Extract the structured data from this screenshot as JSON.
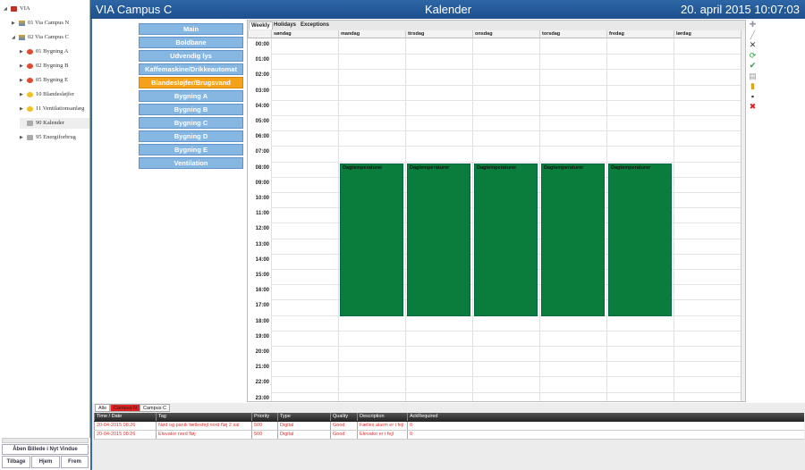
{
  "tree": [
    {
      "label": "VIA",
      "icon": "factory-icon",
      "arrow": "◢",
      "level": 0,
      "color": "#c0302a"
    },
    {
      "label": "01 Via Campus N",
      "icon": "campus-icon",
      "arrow": "▶",
      "level": 1,
      "color": "#e6a020"
    },
    {
      "label": "02 Via Campus C",
      "icon": "campus-icon",
      "arrow": "◢",
      "level": 1,
      "color": "#e6a020"
    },
    {
      "label": "01 Bygning A",
      "icon": "alarm-red-icon",
      "arrow": "▶",
      "level": 2,
      "color": "#e24a2a"
    },
    {
      "label": "02 Bygning B",
      "icon": "alarm-red-icon",
      "arrow": "▶",
      "level": 2,
      "color": "#e24a2a"
    },
    {
      "label": "05 Bygning E",
      "icon": "alarm-red-icon",
      "arrow": "▶",
      "level": 2,
      "color": "#e24a2a"
    },
    {
      "label": "10 Blandesløjfer",
      "icon": "alarm-yellow-icon",
      "arrow": "▶",
      "level": 2,
      "color": "#f2c020"
    },
    {
      "label": "11 Ventilationsanlæg",
      "icon": "alarm-yellow-icon",
      "arrow": "▶",
      "level": 2,
      "color": "#f2c020"
    },
    {
      "label": "90 Kalender",
      "icon": "printer-icon",
      "arrow": "",
      "level": 2,
      "color": "#aaaaaa",
      "selected": true
    },
    {
      "label": "95 Energiforbrug",
      "icon": "printer-icon",
      "arrow": "▶",
      "level": 2,
      "color": "#aaaaaa"
    }
  ],
  "left_buttons": {
    "open": "Åben Billede i Nyt Vindue",
    "back": "Tilbage",
    "home": "Hjem",
    "forward": "Frem"
  },
  "header": {
    "title": "VIA Campus C",
    "center": "Kalender",
    "datetime": "20. april 2015 10:07:03"
  },
  "nav_buttons": [
    "Main",
    "Boldbane",
    "Udvendig lys",
    "Kaffemaskine/Drikkeautomat",
    "Blandesløjfer/Brugsvand",
    "Bygning A",
    "Bygning B",
    "Bygning C",
    "Bygning D",
    "Bygning E",
    "Ventilation"
  ],
  "nav_active": 4,
  "calendar": {
    "tabs": [
      "Weekly",
      "Holidays",
      "Exceptions"
    ],
    "active_tab": 0,
    "days": [
      "søndag",
      "mandag",
      "tirsdag",
      "onsdag",
      "torsdag",
      "fredag",
      "lørdag"
    ],
    "hours": [
      "00:00",
      "01:00",
      "02:00",
      "03:00",
      "04:00",
      "05:00",
      "06:00",
      "07:00",
      "08:00",
      "09:00",
      "10:00",
      "11:00",
      "12:00",
      "13:00",
      "14:00",
      "15:00",
      "16:00",
      "17:00",
      "18:00",
      "19:00",
      "20:00",
      "21:00",
      "22:00",
      "23:00"
    ],
    "events": [
      {
        "day": 1,
        "start": 8,
        "end": 18,
        "label": "Dagtemperaturer"
      },
      {
        "day": 2,
        "start": 8,
        "end": 18,
        "label": "Dagtemperaturer"
      },
      {
        "day": 3,
        "start": 8,
        "end": 18,
        "label": "Dagtemperaturer"
      },
      {
        "day": 4,
        "start": 8,
        "end": 18,
        "label": "Dagtemperaturer"
      },
      {
        "day": 5,
        "start": 8,
        "end": 18,
        "label": "Dagtemperaturer"
      }
    ],
    "event_color": "#0a7d3c"
  },
  "toolbar": [
    {
      "icon": "add-icon",
      "glyph": "✚",
      "color": "#99a"
    },
    {
      "icon": "edit-icon",
      "glyph": "╱",
      "color": "#99a"
    },
    {
      "icon": "delete-icon",
      "glyph": "✕",
      "color": "#333"
    },
    {
      "icon": "refresh-icon",
      "glyph": "⟳",
      "color": "#2a9a3a"
    },
    {
      "icon": "check-icon",
      "glyph": "✔",
      "color": "#2a9a3a"
    },
    {
      "icon": "print-icon",
      "glyph": "▤",
      "color": "#999"
    },
    {
      "icon": "paste-icon",
      "glyph": "▮",
      "color": "#d9a520"
    },
    {
      "icon": "save-icon",
      "glyph": "▪",
      "color": "#333"
    },
    {
      "icon": "close-icon",
      "glyph": "✖",
      "color": "#d22"
    }
  ],
  "alarms": {
    "tabs": [
      {
        "label": "Alle",
        "color": "#ffffff"
      },
      {
        "label": "Campus N",
        "color": "#e02020"
      },
      {
        "label": "Campus C",
        "color": "#f6f6f6"
      }
    ],
    "columns": [
      "Time / Date",
      "Tag",
      "Priority",
      "Type",
      "Quality",
      "Description",
      "AckRequired"
    ],
    "rows": [
      [
        "20-04-2015 08:26",
        "Nød og panik fællesfejl nord fløj 2 sal",
        "500",
        "Digital",
        "Good",
        "Fælles alarm er i fejl",
        "0"
      ],
      [
        "20-04-2015 08:26",
        "Elevator nord fløj",
        "500",
        "Digital",
        "Good",
        "Elevator er i fejl",
        "0"
      ]
    ],
    "text_color": "#e03030"
  }
}
